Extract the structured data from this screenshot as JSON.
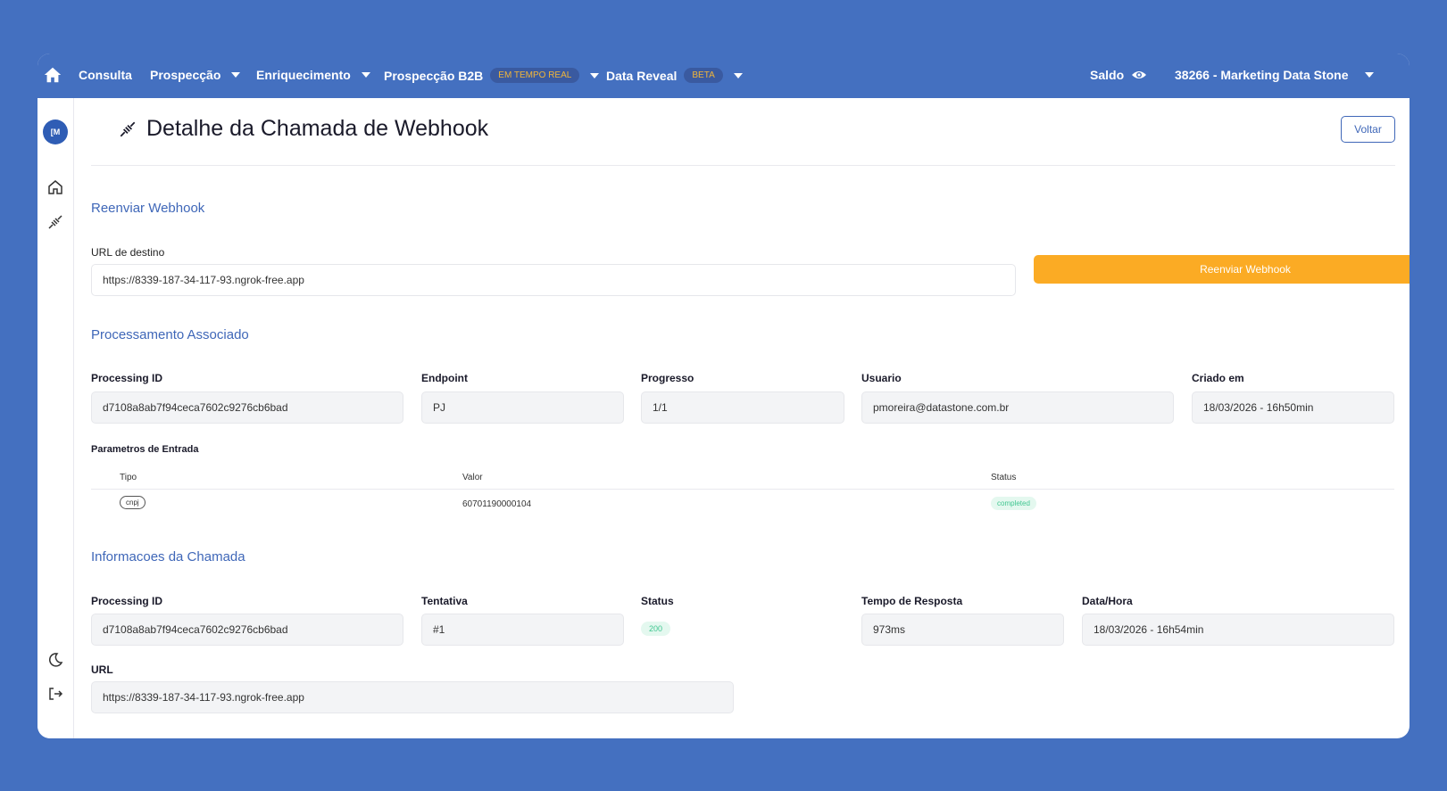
{
  "nav": {
    "items": [
      {
        "label": "Consulta",
        "has_caret": false
      },
      {
        "label": "Prospecção",
        "has_caret": true
      },
      {
        "label": "Enriquecimento",
        "has_caret": true
      },
      {
        "label": "Prospecção B2B",
        "badge": "EM TEMPO REAL",
        "has_caret": true
      },
      {
        "label": "Data Reveal",
        "badge": "BETA",
        "has_caret": true
      }
    ],
    "saldo_label": "Saldo",
    "account_label": "38266 - Marketing Data Stone"
  },
  "sidebar": {
    "avatar_initials": "[M"
  },
  "page": {
    "title": "Detalhe da Chamada de Webhook",
    "back_label": "Voltar"
  },
  "resend": {
    "section_title": "Reenviar Webhook",
    "url_label": "URL de destino",
    "url_value": "https://8339-187-34-117-93.ngrok-free.app",
    "button_label": "Reenviar Webhook"
  },
  "processing": {
    "section_title": "Processamento Associado",
    "fields": [
      {
        "label": "Processing ID",
        "value": "d7108a8ab7f94ceca7602c9276cb6bad"
      },
      {
        "label": "Endpoint",
        "value": "PJ"
      },
      {
        "label": "Progresso",
        "value": "1/1"
      },
      {
        "label": "Usuario",
        "value": "pmoreira@datastone.com.br"
      },
      {
        "label": "Criado em",
        "value": "18/03/2026 - 16h50min"
      }
    ],
    "params_title": "Parametros de Entrada",
    "params_columns": [
      "Tipo",
      "Valor",
      "Status"
    ],
    "params_rows": [
      {
        "tipo": "cnpj",
        "valor": "60701190000104",
        "status": "completed"
      }
    ]
  },
  "call": {
    "section_title": "Informacoes da Chamada",
    "fields": [
      {
        "label": "Processing ID",
        "value": "d7108a8ab7f94ceca7602c9276cb6bad"
      },
      {
        "label": "Tentativa",
        "value": "#1"
      },
      {
        "label": "Status",
        "value": "200"
      },
      {
        "label": "Tempo de Resposta",
        "value": "973ms"
      },
      {
        "label": "Data/Hora",
        "value": "18/03/2026 - 16h54min"
      }
    ],
    "url_label": "URL",
    "url_value": "https://8339-187-34-117-93.ngrok-free.app"
  },
  "colors": {
    "brand": "#4470c0",
    "accent": "#fbab24",
    "link": "#3f67b8",
    "success": "#40c690"
  }
}
